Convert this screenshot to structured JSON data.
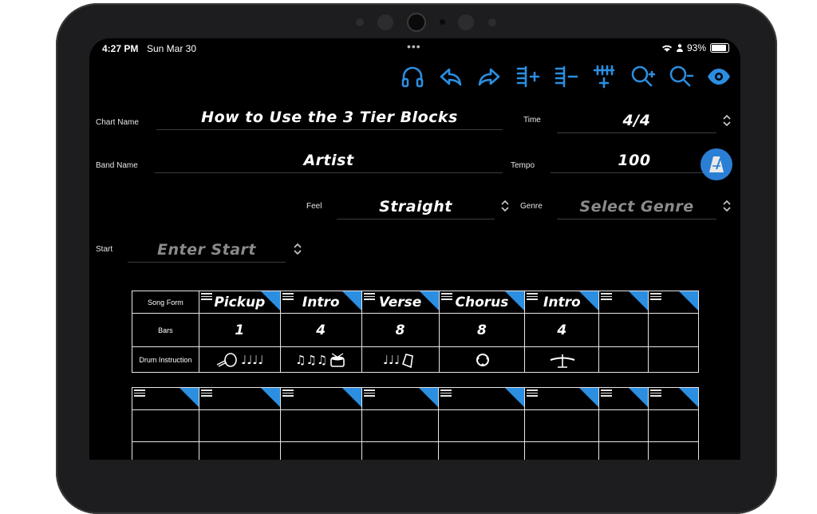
{
  "status": {
    "time": "4:27 PM",
    "date": "Sun Mar 30",
    "battery": "93%"
  },
  "toolbar": {
    "icons": [
      "headphones-icon",
      "undo-icon",
      "redo-icon",
      "add-column-icon",
      "remove-column-icon",
      "add-row-icon",
      "zoom-in-icon",
      "zoom-out-icon",
      "eye-icon"
    ],
    "accent": "#2b8ee0"
  },
  "form": {
    "chart_name_label": "Chart Name",
    "chart_name_value": "How to Use the 3 Tier Blocks",
    "band_name_label": "Band Name",
    "band_name_value": "Artist",
    "time_label": "Time",
    "time_value": "4/4",
    "tempo_label": "Tempo",
    "tempo_value": "100",
    "feel_label": "Feel",
    "feel_value": "Straight",
    "genre_label": "Genre",
    "genre_placeholder": "Select Genre",
    "start_label": "Start",
    "start_placeholder": "Enter Start"
  },
  "grid": {
    "row_labels": [
      "Song Form",
      "Bars",
      "Drum Instruction"
    ],
    "sections": [
      {
        "name": "Pickup",
        "bars": "1",
        "drum": "♩♩♩♩"
      },
      {
        "name": "Intro",
        "bars": "4",
        "drum": "♫♫♫"
      },
      {
        "name": "Verse",
        "bars": "8",
        "drum": "♩♩♩"
      },
      {
        "name": "Chorus",
        "bars": "8",
        "drum": ""
      },
      {
        "name": "Intro",
        "bars": "4",
        "drum": ""
      },
      {
        "name": "",
        "bars": "",
        "drum": ""
      },
      {
        "name": "",
        "bars": "",
        "drum": ""
      }
    ]
  }
}
